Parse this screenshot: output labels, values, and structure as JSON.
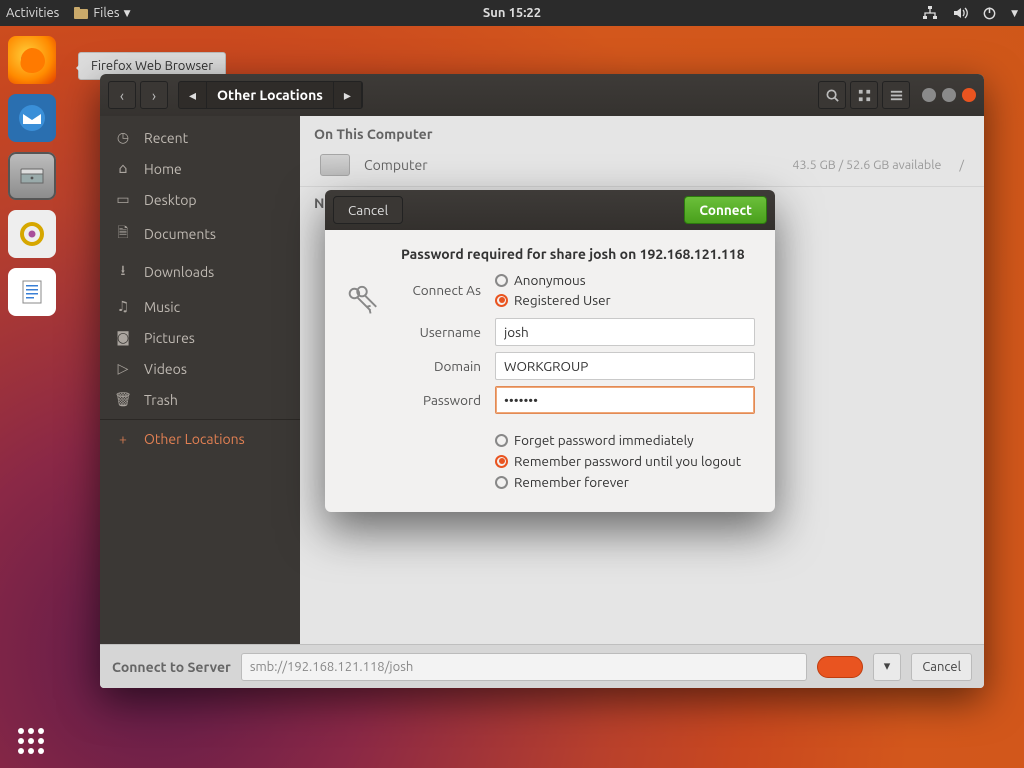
{
  "topbar": {
    "activities": "Activities",
    "app_menu": "Files",
    "clock": "Sun 15:22"
  },
  "tooltip": "Firefox Web Browser",
  "fm": {
    "breadcrumb": "Other Locations",
    "sidebar": [
      {
        "icon": "◷",
        "label": "Recent"
      },
      {
        "icon": "⌂",
        "label": "Home"
      },
      {
        "icon": "▭",
        "label": "Desktop"
      },
      {
        "icon": "🗎",
        "label": "Documents"
      },
      {
        "icon": "⭳",
        "label": "Downloads"
      },
      {
        "icon": "♫",
        "label": "Music"
      },
      {
        "icon": "◙",
        "label": "Pictures"
      },
      {
        "icon": "▷",
        "label": "Videos"
      },
      {
        "icon": "🗑",
        "label": "Trash"
      }
    ],
    "other_locations": {
      "icon": "+",
      "label": "Other Locations"
    },
    "section1": "On This Computer",
    "computer_label": "Computer",
    "computer_size": "43.5 GB / 52.6 GB available",
    "computer_mount": "/",
    "section2": "N",
    "footer_label": "Connect to Server",
    "footer_value": "smb://192.168.121.118/josh",
    "footer_cancel": "Cancel"
  },
  "dialog": {
    "cancel": "Cancel",
    "connect": "Connect",
    "title": "Password required for share josh on 192.168.121.118",
    "connect_as_label": "Connect As",
    "radio_anon": "Anonymous",
    "radio_reg": "Registered User",
    "username_label": "Username",
    "username_value": "josh",
    "domain_label": "Domain",
    "domain_value": "WORKGROUP",
    "password_label": "Password",
    "password_value": "•••••••",
    "remember1": "Forget password immediately",
    "remember2": "Remember password until you logout",
    "remember3": "Remember forever"
  }
}
